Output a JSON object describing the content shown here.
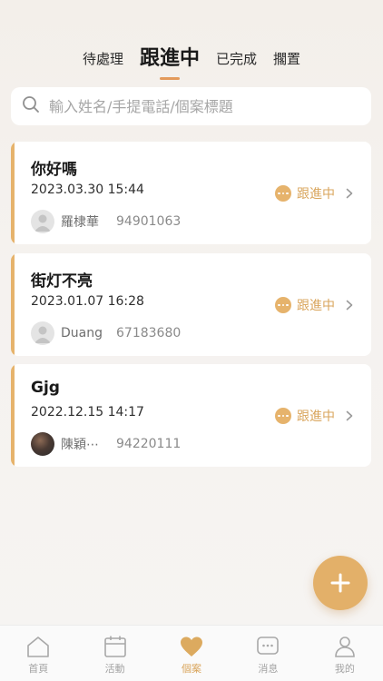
{
  "tabs": [
    {
      "label": "待處理",
      "active": false
    },
    {
      "label": "跟進中",
      "active": true
    },
    {
      "label": "已完成",
      "active": false
    },
    {
      "label": "擱置",
      "active": false
    }
  ],
  "search": {
    "placeholder": "輸入姓名/手提電話/個案標題",
    "icon": "search-icon"
  },
  "cases": [
    {
      "title": "你好嗎",
      "datetime": "2023.03.30 15:44",
      "user_name": "羅棣華",
      "phone": "94901063",
      "status": "跟進中",
      "avatar": "default-avatar"
    },
    {
      "title": "街灯不亮",
      "datetime": "2023.01.07 16:28",
      "user_name": "Duang",
      "phone": "67183680",
      "status": "跟進中",
      "avatar": "default-avatar"
    },
    {
      "title": "Gjg",
      "datetime": "2022.12.15 14:17",
      "user_name": "陳穎⋯",
      "phone": "94220111",
      "status": "跟進中",
      "avatar": "photo-avatar"
    }
  ],
  "fab": {
    "icon": "plus-icon"
  },
  "nav": [
    {
      "label": "首頁",
      "icon": "home-icon",
      "active": false
    },
    {
      "label": "活動",
      "icon": "calendar-icon",
      "active": false
    },
    {
      "label": "個案",
      "icon": "heart-icon",
      "active": true
    },
    {
      "label": "消息",
      "icon": "message-icon",
      "active": false
    },
    {
      "label": "我的",
      "icon": "profile-icon",
      "active": false
    }
  ],
  "colors": {
    "accent": "#e6b36c",
    "status_text": "#d9a55c",
    "tab_underline": "#e39a5b"
  }
}
